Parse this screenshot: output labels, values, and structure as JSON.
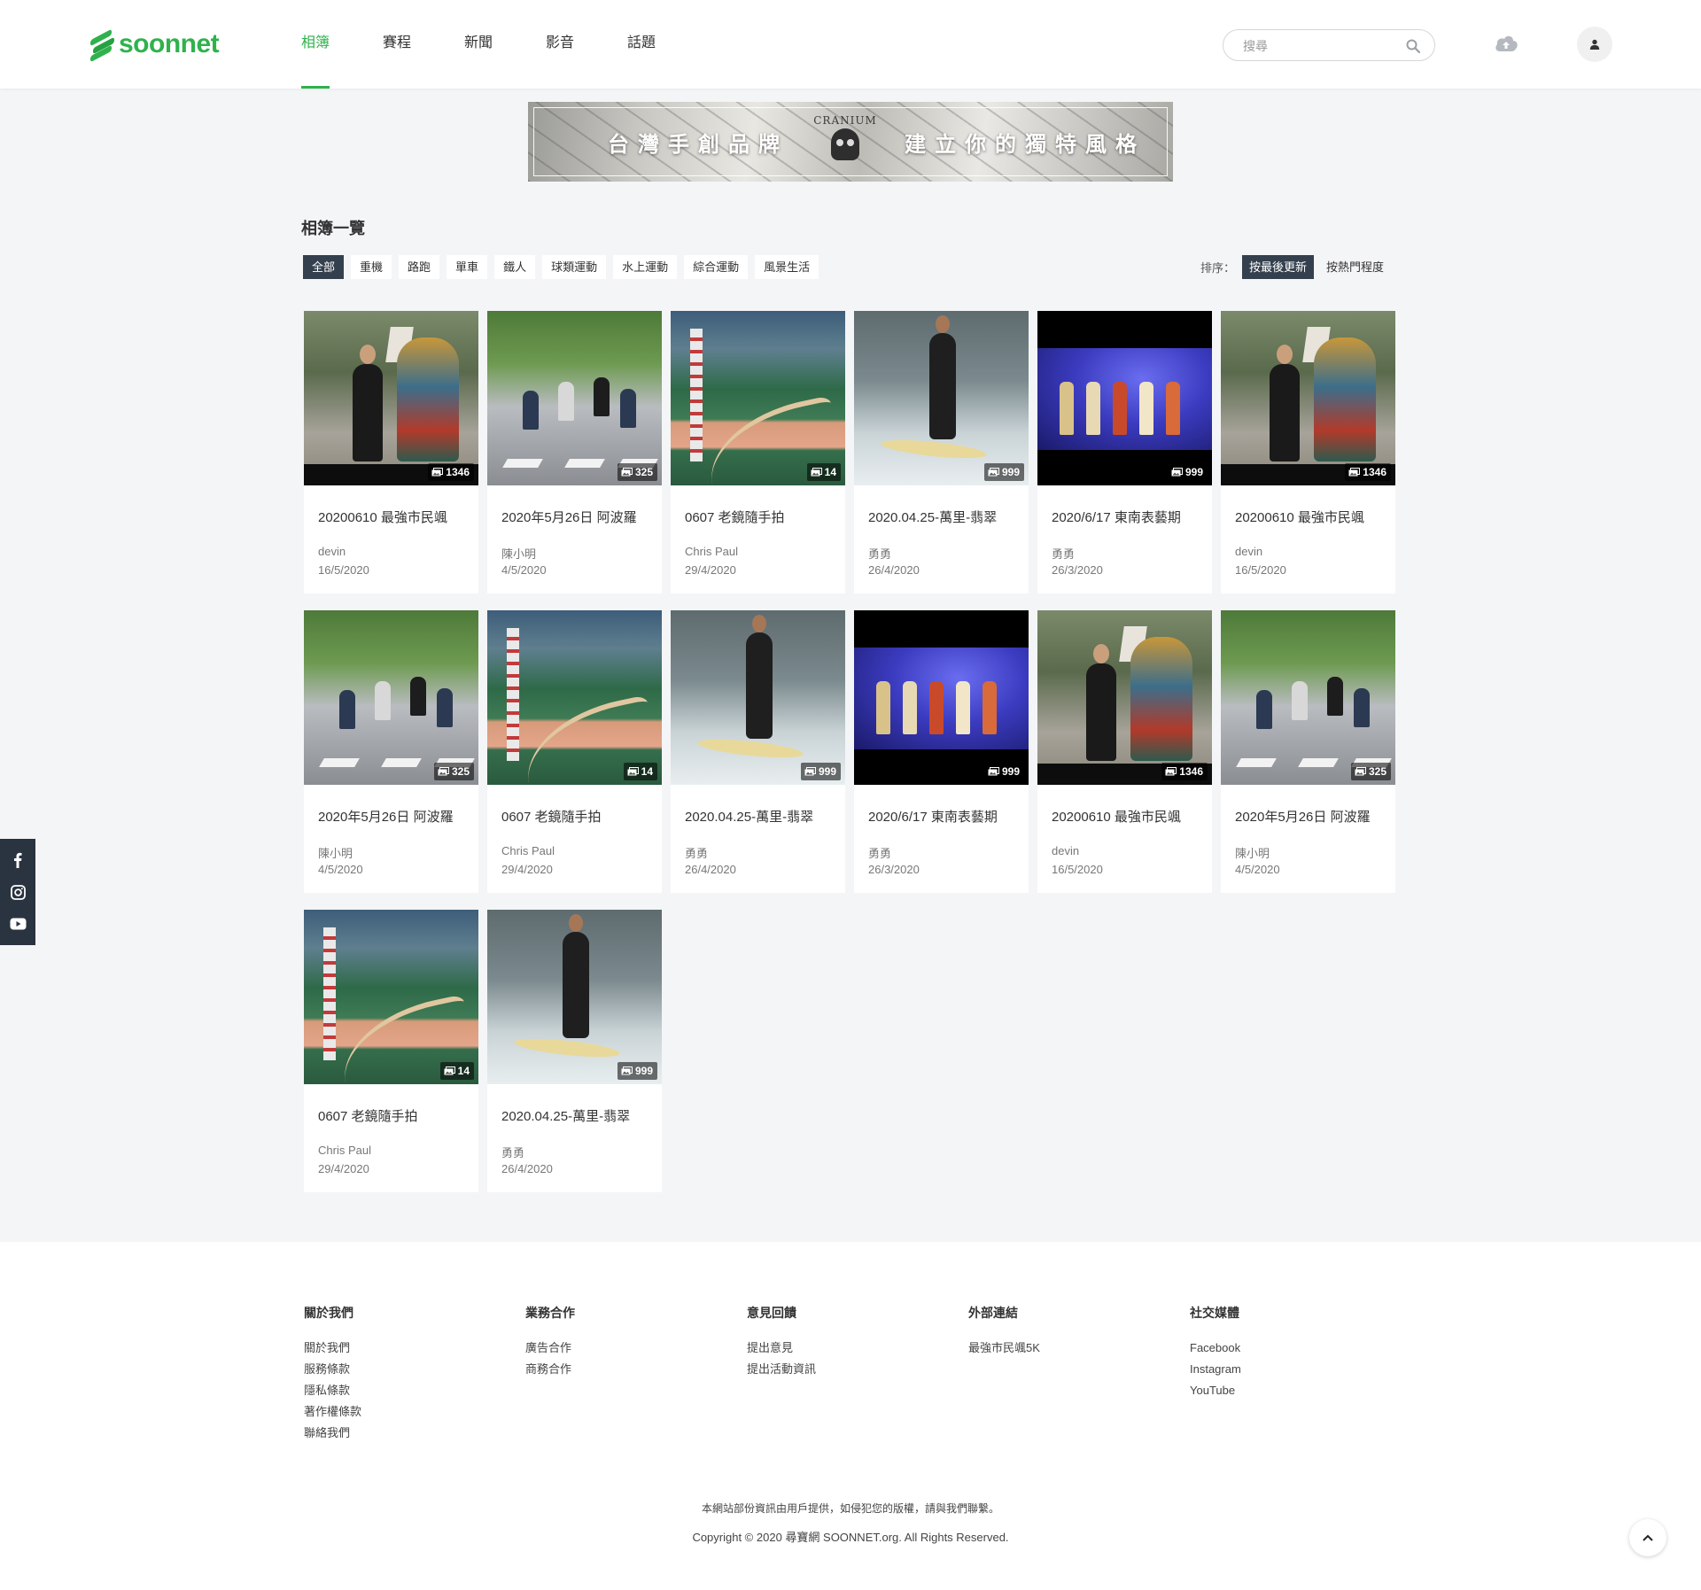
{
  "header": {
    "logo_text": "soonnet",
    "nav": [
      "相簿",
      "賽程",
      "新聞",
      "影音",
      "話題"
    ],
    "search_placeholder": "搜尋"
  },
  "banner": {
    "left_text": "台灣手創品牌",
    "logo_text": "CRANIUM",
    "right_text": "建立你的獨特風格"
  },
  "main": {
    "section_title": "相簿一覽",
    "filters": [
      "全部",
      "重機",
      "路跑",
      "單車",
      "鐵人",
      "球類運動",
      "水上運動",
      "綜合運動",
      "風景生活"
    ],
    "sort_label": "排序：",
    "sort_options": [
      "按最後更新",
      "按熱門程度"
    ]
  },
  "albums": [
    {
      "title": "20200610 最強市民颯",
      "author": "devin",
      "date": "16/5/2020",
      "count": "1346",
      "scene": "parade"
    },
    {
      "title": "2020年5月26日 阿波羅",
      "author": "陳小明",
      "date": "4/5/2020",
      "count": "325",
      "scene": "cycle"
    },
    {
      "title": "0607 老鏡隨手拍",
      "author": "Chris Paul",
      "date": "29/4/2020",
      "count": "14",
      "scene": "city"
    },
    {
      "title": "2020.04.25-萬里-翡翠",
      "author": "勇勇",
      "date": "26/4/2020",
      "count": "999",
      "scene": "surf"
    },
    {
      "title": "2020/6/17 東南表藝期",
      "author": "勇勇",
      "date": "26/3/2020",
      "count": "999",
      "scene": "concert"
    },
    {
      "title": "20200610 最強市民颯",
      "author": "devin",
      "date": "16/5/2020",
      "count": "1346",
      "scene": "parade"
    },
    {
      "title": "2020年5月26日 阿波羅",
      "author": "陳小明",
      "date": "4/5/2020",
      "count": "325",
      "scene": "cycle"
    },
    {
      "title": "0607 老鏡隨手拍",
      "author": "Chris Paul",
      "date": "29/4/2020",
      "count": "14",
      "scene": "city"
    },
    {
      "title": "2020.04.25-萬里-翡翠",
      "author": "勇勇",
      "date": "26/4/2020",
      "count": "999",
      "scene": "surf"
    },
    {
      "title": "2020/6/17 東南表藝期",
      "author": "勇勇",
      "date": "26/3/2020",
      "count": "999",
      "scene": "concert"
    },
    {
      "title": "20200610 最強市民颯",
      "author": "devin",
      "date": "16/5/2020",
      "count": "1346",
      "scene": "parade"
    },
    {
      "title": "2020年5月26日 阿波羅",
      "author": "陳小明",
      "date": "4/5/2020",
      "count": "325",
      "scene": "cycle"
    },
    {
      "title": "0607 老鏡隨手拍",
      "author": "Chris Paul",
      "date": "29/4/2020",
      "count": "14",
      "scene": "city"
    },
    {
      "title": "2020.04.25-萬里-翡翠",
      "author": "勇勇",
      "date": "26/4/2020",
      "count": "999",
      "scene": "surf"
    }
  ],
  "social_bar": [
    "facebook-icon",
    "instagram-icon",
    "youtube-icon"
  ],
  "footer": {
    "columns": [
      {
        "title": "關於我們",
        "links": [
          "關於我們",
          "服務條款",
          "隱私條款",
          "著作權條款",
          "聯絡我們"
        ]
      },
      {
        "title": "業務合作",
        "links": [
          "廣告合作",
          "商務合作"
        ]
      },
      {
        "title": "意見回饋",
        "links": [
          "提出意見",
          "提出活動資訊"
        ]
      },
      {
        "title": "外部連結",
        "links": [
          "最強市民颯5K"
        ]
      },
      {
        "title": "社交媒體",
        "links": [
          "Facebook",
          "Instagram",
          "YouTube"
        ]
      }
    ],
    "note": "本網站部份資訊由用戶提供，如侵犯您的版權，請與我們聯繫。",
    "copyright": "Copyright © 2020 尋寶網 SOONNET.org. All Rights Reserved."
  },
  "colors": {
    "brand": "#2fb24c",
    "dark": "#34404e",
    "page_bg": "#f4f5f7"
  }
}
